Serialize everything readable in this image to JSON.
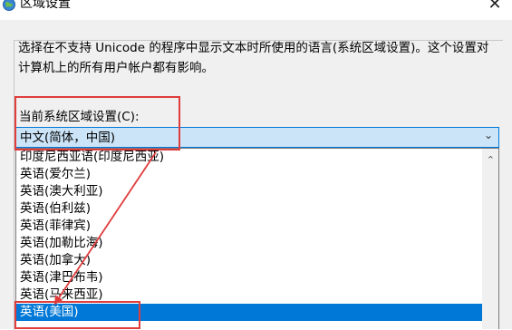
{
  "window": {
    "title": "区域设置",
    "icon": "globe-icon"
  },
  "description": "选择在不支持 Unicode 的程序中显示文本时所使用的语言(系统区域设置)。这个设置对计算机上的所有用户帐户都有影响。",
  "current_locale_label": "当前系统区域设置(C):",
  "selected_value": "中文(简体，中国)",
  "options": [
    {
      "label": "印度尼西亚语(印度尼西亚)",
      "selected": false
    },
    {
      "label": "英语(爱尔兰)",
      "selected": false
    },
    {
      "label": "英语(澳大利亚)",
      "selected": false
    },
    {
      "label": "英语(伯利兹)",
      "selected": false
    },
    {
      "label": "英语(菲律宾)",
      "selected": false
    },
    {
      "label": "英语(加勒比海)",
      "selected": false
    },
    {
      "label": "英语(加拿大)",
      "selected": false
    },
    {
      "label": "英语(津巴布韦)",
      "selected": false
    },
    {
      "label": "英语(马来西亚)",
      "selected": false
    },
    {
      "label": "英语(美国)",
      "selected": true
    }
  ],
  "colors": {
    "accent": "#0078d7",
    "annotation": "#e03c3c",
    "combo_bg": "#cce4f7"
  }
}
